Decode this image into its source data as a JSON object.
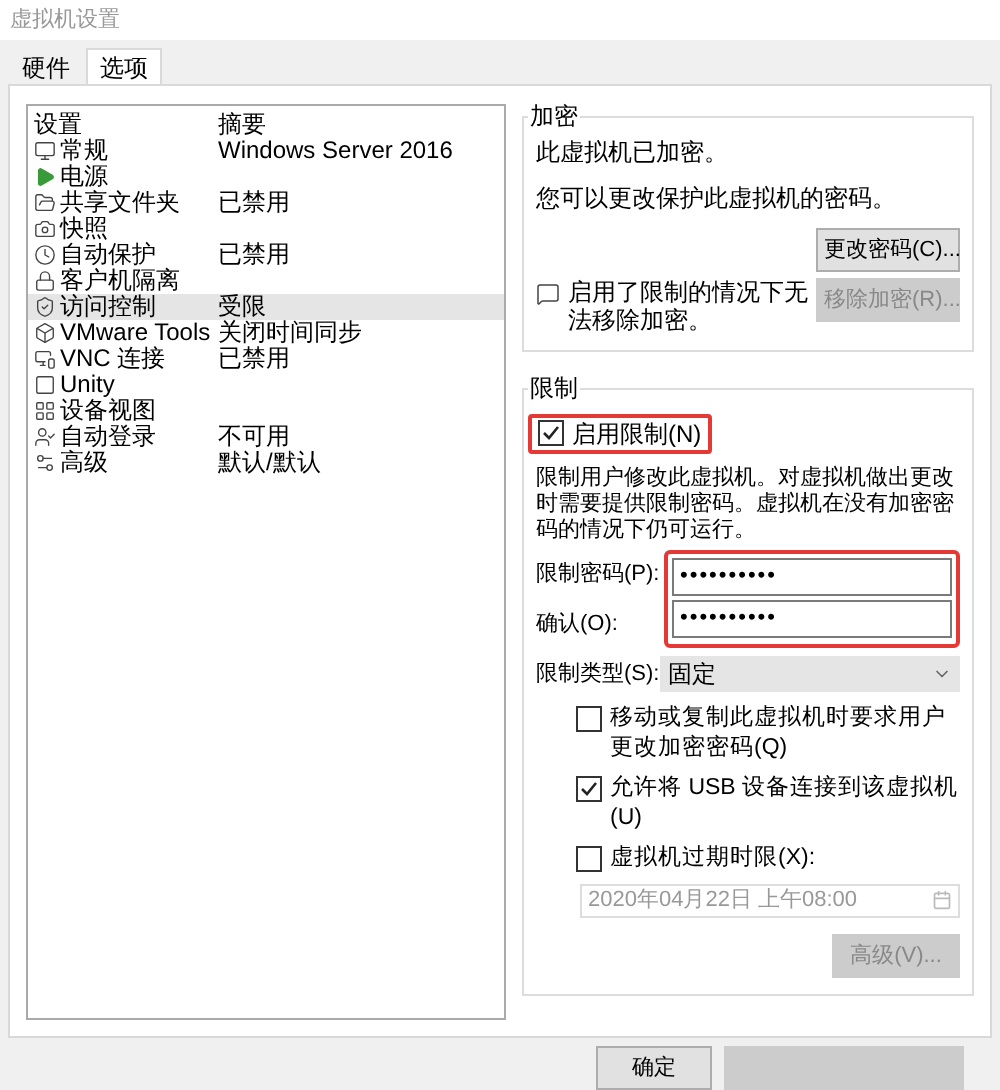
{
  "window": {
    "title": "虚拟机设置"
  },
  "tabs": [
    {
      "label": "硬件",
      "selected": false
    },
    {
      "label": "选项",
      "selected": true
    }
  ],
  "settings_list": {
    "columns": [
      "设置",
      "摘要"
    ],
    "rows": [
      {
        "name": "常规",
        "summary": "Windows Server 2016",
        "selected": false
      },
      {
        "name": "电源",
        "selected": false
      },
      {
        "name": "共享文件夹",
        "summary": "已禁用",
        "selected": false
      },
      {
        "name": "快照",
        "selected": false
      },
      {
        "name": "自动保护",
        "summary": "已禁用",
        "selected": false
      },
      {
        "name": "客户机隔离",
        "selected": false
      },
      {
        "name": "访问控制",
        "summary": "受限",
        "selected": true
      },
      {
        "name": "VMware Tools",
        "summary": "关闭时间同步",
        "selected": false
      },
      {
        "name": "VNC 连接",
        "summary": "已禁用",
        "selected": false
      },
      {
        "name": "Unity",
        "selected": false
      },
      {
        "name": "设备视图",
        "selected": false
      },
      {
        "name": "自动登录",
        "summary": "不可用",
        "selected": false
      },
      {
        "name": "高级",
        "summary": "默认/默认",
        "selected": false
      }
    ]
  },
  "encryption": {
    "title": "加密",
    "status": "此虚拟机已加密。",
    "hint": "您可以更改保护此虚拟机的密码。",
    "change_button": {
      "label": "更改密码(C)...",
      "disabled": false
    },
    "note": "启用了限制的情况下无法移除加密。",
    "remove_button": {
      "label": "移除加密(R)...",
      "disabled": true
    }
  },
  "restrictions": {
    "title": "限制",
    "enable": {
      "label": "启用限制(N)",
      "checked": true,
      "highlighted": true
    },
    "description": "限制用户修改此虚拟机。对虚拟机做出更改时需要提供限制密码。虚拟机在没有加密密码的情况下仍可运行。",
    "passwords_highlighted": true,
    "fields": [
      {
        "label": "限制密码(P):",
        "value": "••••••••••"
      },
      {
        "label": "确认(O):",
        "value": "••••••••••"
      }
    ],
    "type": {
      "label": "限制类型(S):",
      "value": "固定"
    },
    "options": [
      {
        "label": "移动或复制此虚拟机时要求用户更改加密密码(Q)",
        "checked": false
      },
      {
        "label": "允许将 USB 设备连接到该虚拟机(U)",
        "checked": true
      },
      {
        "label": "虚拟机过期时限(X):",
        "checked": false
      }
    ],
    "expiry": {
      "value": "2020年04月22日 上午08:00",
      "disabled": true
    },
    "advanced_button": {
      "label": "高级(V)...",
      "disabled": true
    }
  },
  "buttons": [
    {
      "label": "确定",
      "disabled": false
    },
    {
      "disabled": true
    }
  ]
}
